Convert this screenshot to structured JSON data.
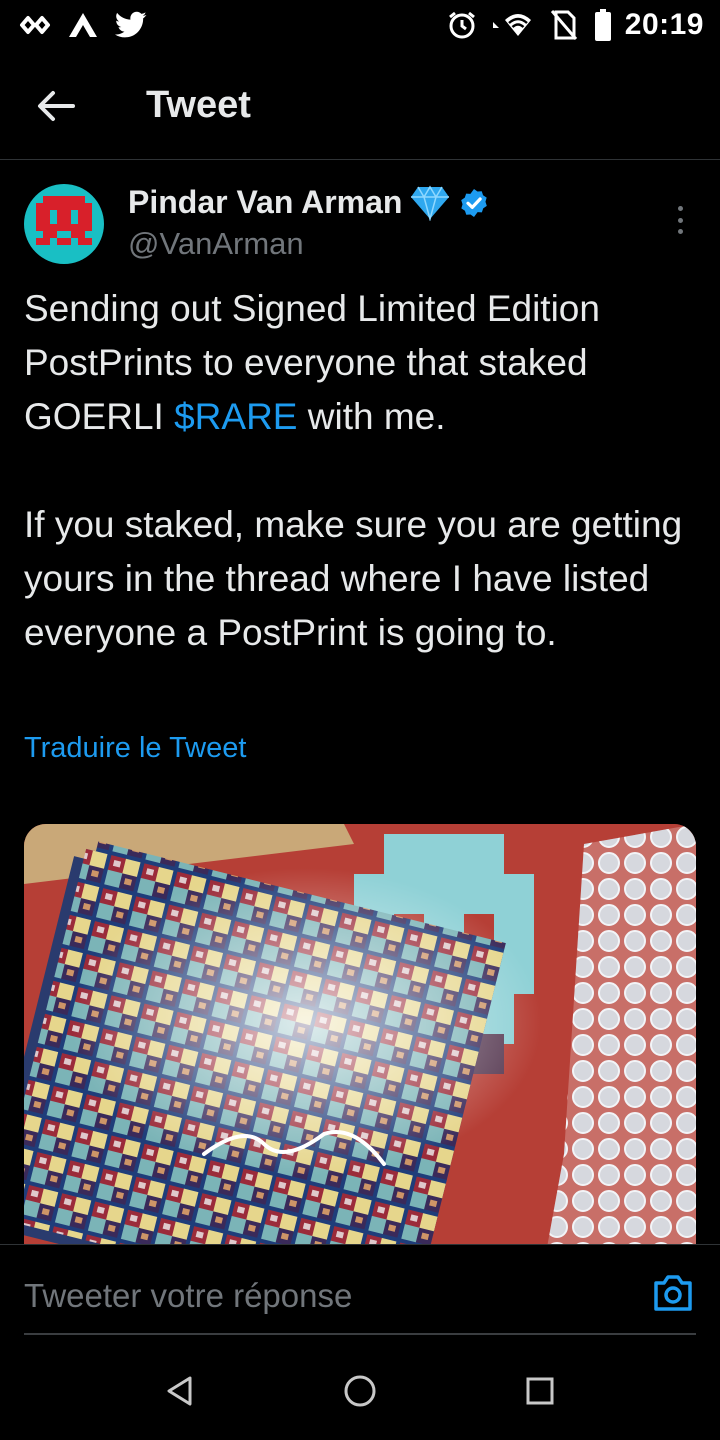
{
  "status_bar": {
    "time": "20:19",
    "left_icons": [
      "link-app-icon",
      "triangle-app-icon",
      "twitter-bird-icon"
    ],
    "right_icons": [
      "alarm-icon",
      "wifi-icon",
      "no-sim-icon",
      "battery-icon"
    ]
  },
  "header": {
    "title": "Tweet"
  },
  "tweet": {
    "display_name": "Pindar Van Arman",
    "handle": "@VanArman",
    "paragraph1_a": "Sending out Signed Limited Edition PostPrints to everyone that staked GOERLI ",
    "cashtag": "$RARE",
    "paragraph1_b": " with me.",
    "paragraph2": "If you staked, make sure you are getting yours in the thread where I have listed everyone a PostPrint is going to.",
    "translate_label": "Traduire le Tweet"
  },
  "reply": {
    "placeholder": "Tweeter votre réponse"
  },
  "colors": {
    "accent": "#1d9bf0",
    "background": "#000000",
    "avatar_bg": "#19bfc4",
    "avatar_invader": "#d8202a"
  }
}
